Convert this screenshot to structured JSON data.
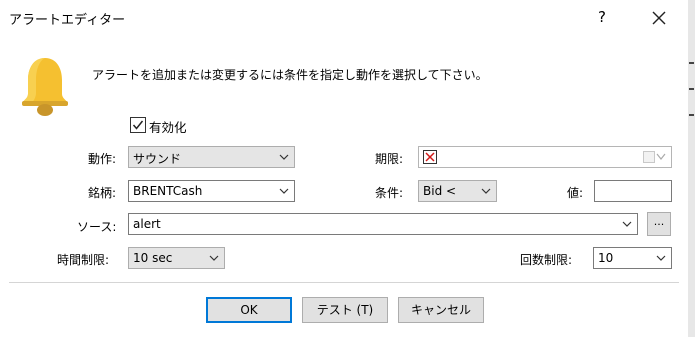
{
  "window": {
    "title": "アラートエディター",
    "help_label": "?",
    "close_icon": "close-icon"
  },
  "message": "アラートを追加または変更するには条件を指定し動作を選択して下さい。",
  "icons": {
    "bell": "bell-icon",
    "colors": {
      "bell": "#f5c030",
      "bell_shade": "#c8952a",
      "accent": "#0078d7"
    }
  },
  "enabled": {
    "label": "有効化",
    "checked": true
  },
  "action": {
    "label": "動作:",
    "value": "サウンド"
  },
  "expiry": {
    "label": "期限:",
    "value": ""
  },
  "symbol": {
    "label": "銘柄:",
    "value": "BRENTCash"
  },
  "condition": {
    "label": "条件:",
    "value": "Bid <"
  },
  "value": {
    "label": "値:",
    "value": ""
  },
  "source": {
    "label": "ソース:",
    "value": "alert",
    "browse_label": "..."
  },
  "timeout": {
    "label": "時間制限:",
    "value": "10 sec"
  },
  "max_iterations": {
    "label": "回数制限:",
    "value": "10"
  },
  "buttons": {
    "ok": "OK",
    "test": "テスト (T)",
    "cancel": "キャンセル"
  }
}
